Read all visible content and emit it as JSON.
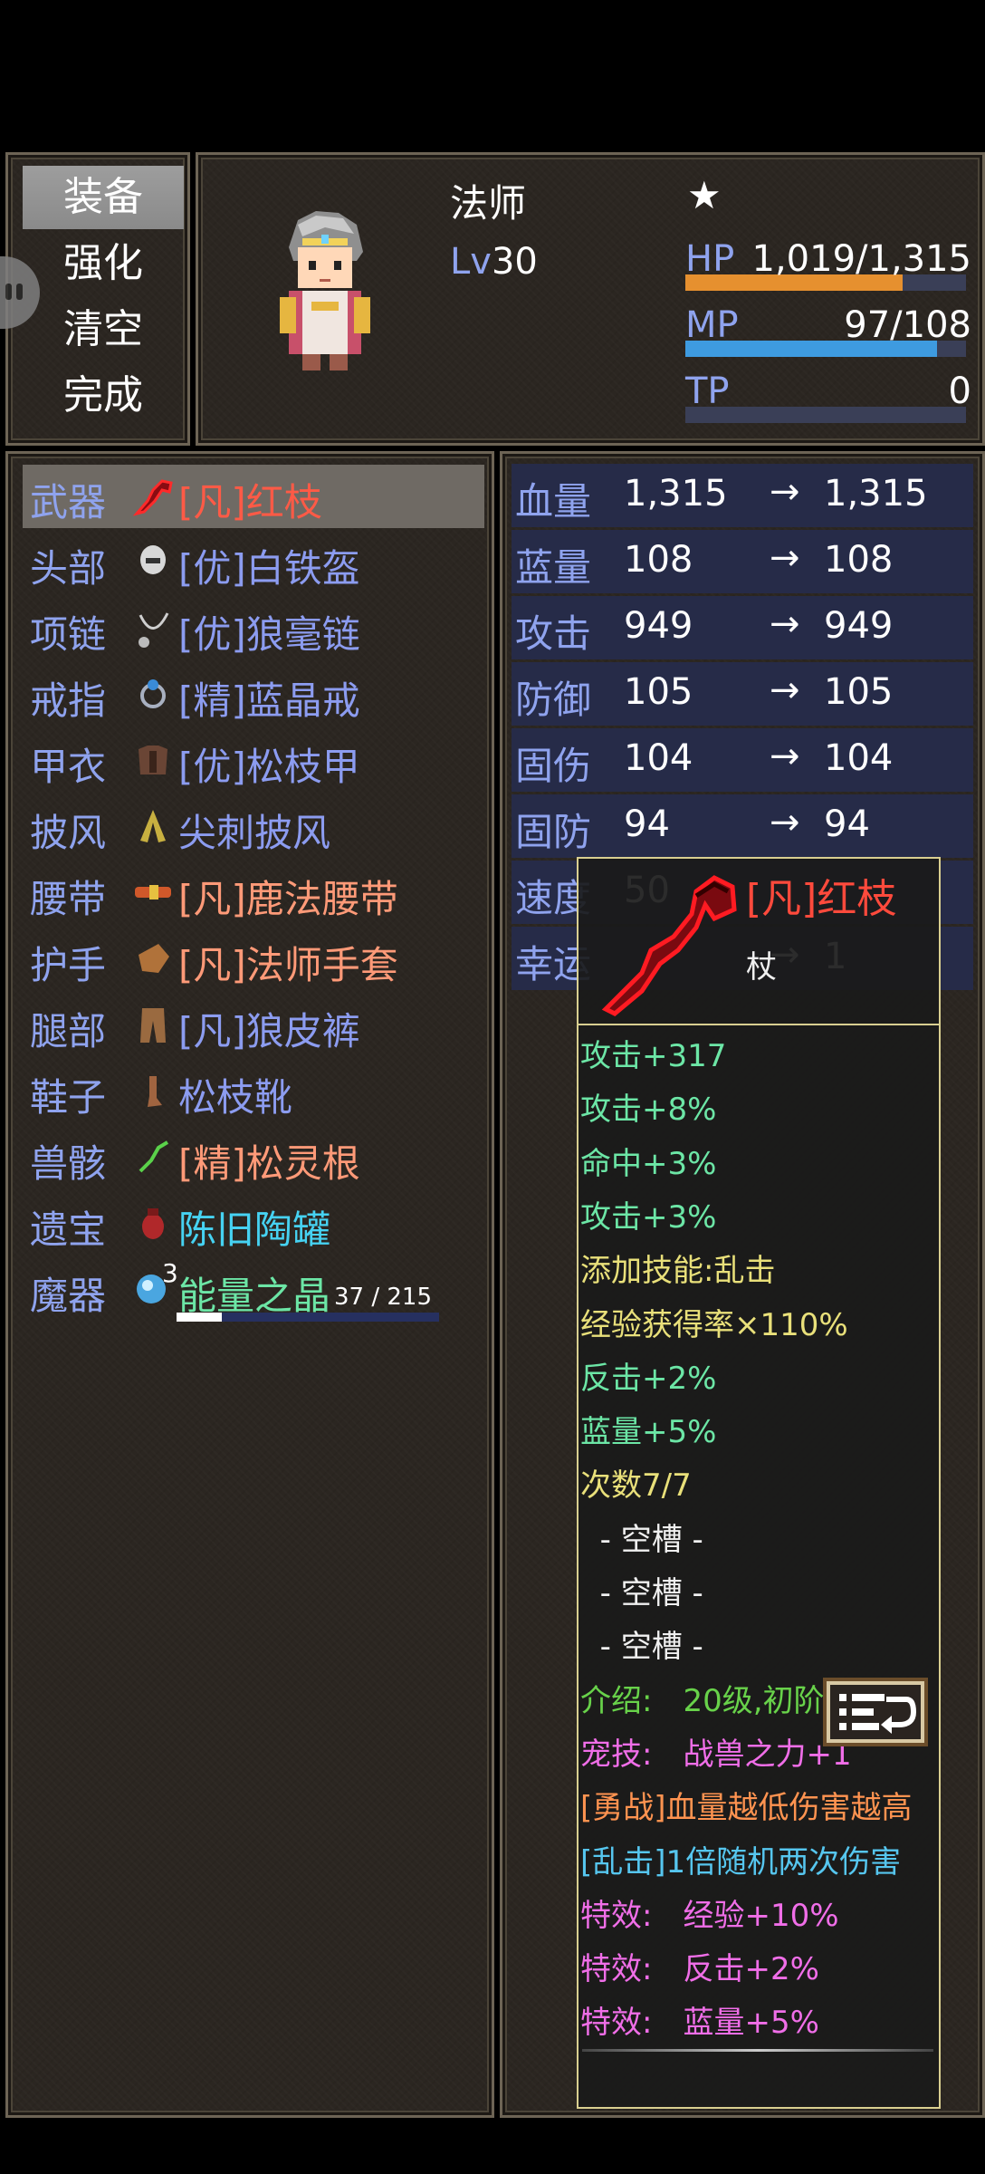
{
  "menu": {
    "items": [
      {
        "label": "装备",
        "active": true
      },
      {
        "label": "强化",
        "active": false
      },
      {
        "label": "清空",
        "active": false
      },
      {
        "label": "完成",
        "active": false
      }
    ]
  },
  "character": {
    "class_name": "法师",
    "star": "★",
    "level_prefix": "Lv",
    "level": "30",
    "hp_label": "HP",
    "hp_value": "1,019/1,315",
    "hp_fill": 0.775,
    "mp_label": "MP",
    "mp_value": "97/108",
    "mp_fill": 0.898,
    "tp_label": "TP",
    "tp_value": "0",
    "tp_fill": 0
  },
  "equipment": [
    {
      "slot": "武器",
      "name": "[凡]红枝",
      "color": "red",
      "icon": "staff-icon",
      "selected": true
    },
    {
      "slot": "头部",
      "name": "[优]白铁盔",
      "color": "blue",
      "icon": "helmet-icon"
    },
    {
      "slot": "项链",
      "name": "[优]狼毫链",
      "color": "blue",
      "icon": "necklace-icon"
    },
    {
      "slot": "戒指",
      "name": "[精]蓝晶戒",
      "color": "blue",
      "icon": "ring-icon"
    },
    {
      "slot": "甲衣",
      "name": "[优]松枝甲",
      "color": "blue",
      "icon": "armor-icon"
    },
    {
      "slot": "披风",
      "name": "尖刺披风",
      "color": "blue",
      "icon": "cloak-icon"
    },
    {
      "slot": "腰带",
      "name": "[凡]鹿法腰带",
      "color": "orange",
      "icon": "belt-icon"
    },
    {
      "slot": "护手",
      "name": "[凡]法师手套",
      "color": "orange",
      "icon": "glove-icon"
    },
    {
      "slot": "腿部",
      "name": "[凡]狼皮裤",
      "color": "blue",
      "icon": "pants-icon"
    },
    {
      "slot": "鞋子",
      "name": "松枝靴",
      "color": "blue",
      "icon": "boot-icon"
    },
    {
      "slot": "兽骸",
      "name": "[精]松灵根",
      "color": "orange",
      "icon": "root-icon"
    },
    {
      "slot": "遗宝",
      "name": "陈旧陶罐",
      "color": "cyan",
      "icon": "jar-icon"
    },
    {
      "slot": "魔器",
      "name": "能量之晶",
      "color": "green",
      "icon": "crystal-icon",
      "count": "3",
      "progress_text": "37 / 215",
      "progress": 0.172
    }
  ],
  "stats": [
    {
      "label": "血量",
      "before": "1,315",
      "arrow": "→",
      "after": "1,315"
    },
    {
      "label": "蓝量",
      "before": "108",
      "arrow": "→",
      "after": "108"
    },
    {
      "label": "攻击",
      "before": "949",
      "arrow": "→",
      "after": "949"
    },
    {
      "label": "防御",
      "before": "105",
      "arrow": "→",
      "after": "105"
    },
    {
      "label": "固伤",
      "before": "104",
      "arrow": "→",
      "after": "104"
    },
    {
      "label": "固防",
      "before": "94",
      "arrow": "→",
      "after": "94"
    },
    {
      "label": "速度",
      "before": "50",
      "arrow": "",
      "after": ""
    },
    {
      "label": "幸运",
      "before": "",
      "arrow": "→",
      "after": "1"
    }
  ],
  "tooltip": {
    "name": "[凡]红枝",
    "type": "杖",
    "lines": [
      {
        "text": "攻击+317",
        "color": "g"
      },
      {
        "text": "攻击+8%",
        "color": "g"
      },
      {
        "text": "命中+3%",
        "color": "g"
      },
      {
        "text": "攻击+3%",
        "color": "g"
      },
      {
        "text": "添加技能:乱击",
        "color": "y"
      },
      {
        "text": "经验获得率×110%",
        "color": "y"
      },
      {
        "text": "反击+2%",
        "color": "g"
      },
      {
        "text": "蓝量+5%",
        "color": "g"
      },
      {
        "text": "次数7/7",
        "color": "y"
      },
      {
        "text": "  - 空槽 -",
        "color": "w"
      },
      {
        "text": "  - 空槽 -",
        "color": "w"
      },
      {
        "text": "  - 空槽 -",
        "color": "w"
      },
      {
        "text": "介绍:　20级,初阶",
        "color": "gr"
      },
      {
        "text": "宠技:　战兽之力+1",
        "color": "pk"
      },
      {
        "text": "[勇战]血量越低伤害越高",
        "color": "or"
      },
      {
        "text": "[乱击]1倍随机两次伤害",
        "color": "sk"
      },
      {
        "text": "特效:　经验+10%",
        "color": "pk"
      },
      {
        "text": "特效:　反击+2%",
        "color": "pk"
      },
      {
        "text": "特效:　蓝量+5%",
        "color": "pk"
      }
    ]
  },
  "colors": {
    "hp_bar": "#e6902f",
    "mp_bar": "#3e9be0",
    "stat_label": "#8fa3ee",
    "tooltip_border": "#d9cf90"
  }
}
